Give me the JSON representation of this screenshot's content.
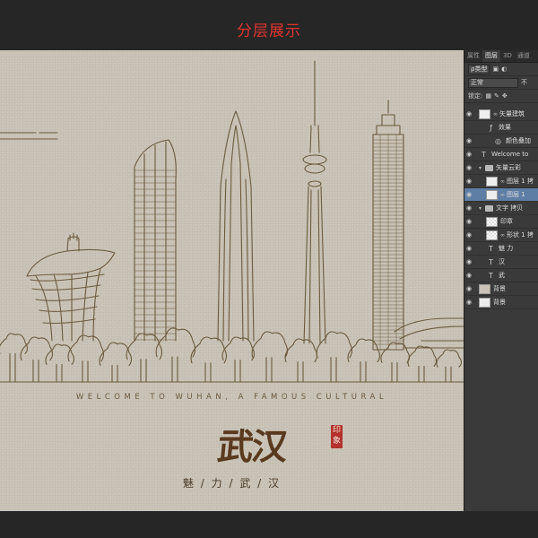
{
  "header": {
    "title": "分层展示"
  },
  "artwork": {
    "welcome_text": "WELCOME TO WUHAN, A FAMOUS CULTURAL",
    "title_calligraphy": "武汉",
    "seal_chars": [
      "印",
      "象"
    ],
    "subtitle": "魅 / 力 / 武 / 汉",
    "ink_color": "#6b5a3e",
    "paper_color": "#c9c3b7",
    "seal_color": "#b4312c"
  },
  "panel": {
    "tabs": [
      "属性",
      "图层",
      "3D",
      "通道"
    ],
    "active_tab": "图层",
    "filter_select": "ρ类型",
    "blend_mode": "正常",
    "opacity_label": "不",
    "lock_label": "锁定:",
    "layers": [
      {
        "name": "矢量建筑",
        "kind": "smart",
        "indent": 0,
        "visible": true,
        "linked": true
      },
      {
        "name": "效果",
        "kind": "effects",
        "indent": 1,
        "visible": false
      },
      {
        "name": "颜色叠加",
        "kind": "effect",
        "indent": 2,
        "visible": true
      },
      {
        "name": "Welcome to",
        "kind": "text",
        "indent": 0,
        "visible": true
      },
      {
        "name": "矢量云彩",
        "kind": "group",
        "indent": 0,
        "visible": true,
        "expanded": true
      },
      {
        "name": "图层 1 拷",
        "kind": "smart",
        "indent": 1,
        "visible": true,
        "linked": true
      },
      {
        "name": "图层 1",
        "kind": "smart",
        "indent": 1,
        "visible": true,
        "linked": true,
        "selected": true
      },
      {
        "name": "文字 拷贝",
        "kind": "group",
        "indent": 0,
        "visible": true,
        "expanded": true
      },
      {
        "name": "印章",
        "kind": "raster",
        "indent": 1,
        "visible": true
      },
      {
        "name": "形状 1 拷",
        "kind": "raster",
        "indent": 1,
        "visible": true,
        "linked": true
      },
      {
        "name": "魅  力",
        "kind": "text",
        "indent": 1,
        "visible": true
      },
      {
        "name": "汉",
        "kind": "text",
        "indent": 1,
        "visible": true
      },
      {
        "name": "武",
        "kind": "text",
        "indent": 1,
        "visible": true
      },
      {
        "name": "背景",
        "kind": "fill",
        "indent": 0,
        "visible": true
      },
      {
        "name": "背景",
        "kind": "background",
        "indent": 0,
        "visible": true
      }
    ]
  }
}
